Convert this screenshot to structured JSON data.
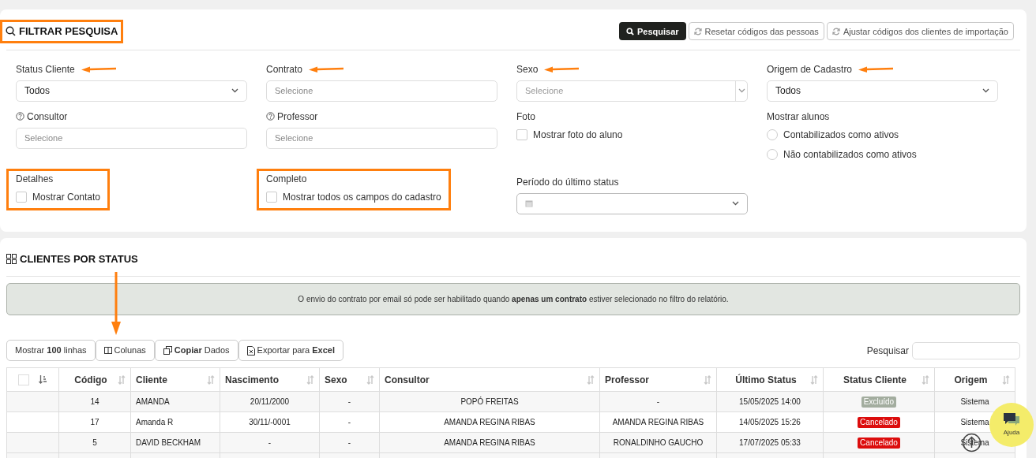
{
  "filter_panel": {
    "title": "FILTRAR PESQUISA",
    "title_highlighted": true,
    "buttons": [
      {
        "label": "Pesquisar",
        "kind": "primary"
      },
      {
        "label": "Resetar códigos das pessoas",
        "kind": "refresh"
      },
      {
        "label": "Ajustar códigos dos clientes de importação",
        "kind": "refresh"
      }
    ],
    "fields": [
      {
        "kind": "select",
        "label": "Status Cliente",
        "value": "Todos",
        "arrow": true,
        "help": false,
        "highlighted": false
      },
      {
        "kind": "input",
        "label": "Contrato",
        "placeholder": "Selecione",
        "arrow": true,
        "help": false,
        "highlighted": false
      },
      {
        "kind": "combo",
        "label": "Sexo",
        "placeholder": "Selecione",
        "arrow": true,
        "help": false,
        "highlighted": false
      },
      {
        "kind": "select",
        "label": "Origem de Cadastro",
        "value": "Todos",
        "arrow": true,
        "help": false,
        "highlighted": false
      },
      {
        "kind": "input",
        "label": "Consultor",
        "placeholder": "Selecione",
        "arrow": false,
        "help": true,
        "highlighted": false
      },
      {
        "kind": "input",
        "label": "Professor",
        "placeholder": "Selecione",
        "arrow": false,
        "help": true,
        "highlighted": false
      },
      {
        "kind": "checkbox",
        "label": "Foto",
        "option": "Mostrar foto do aluno",
        "checked": false,
        "arrow": false,
        "help": false,
        "highlighted": false
      },
      {
        "kind": "radios",
        "label": "Mostrar alunos",
        "options": [
          {
            "label": "Contabilizados como ativos",
            "selected": false
          },
          {
            "label": "Não contabilizados como ativos",
            "selected": false
          }
        ],
        "arrow": false,
        "help": false,
        "highlighted": false
      },
      {
        "kind": "checkbox",
        "label": "Detalhes",
        "option": "Mostrar Contato",
        "checked": false,
        "arrow": false,
        "help": false,
        "highlighted": true
      },
      {
        "kind": "checkbox",
        "label": "Completo",
        "option": "Mostrar todos os campos do cadastro",
        "checked": false,
        "arrow": false,
        "help": false,
        "highlighted": true
      },
      {
        "kind": "date",
        "label": "Período do último status",
        "arrow": false,
        "help": false,
        "highlighted": false
      }
    ]
  },
  "clients_panel": {
    "title": "CLIENTES POR STATUS",
    "alert": "O envio do contrato por email só pode ser habilitado quando **apenas um contrato** estiver selecionado no filtro do relatório.",
    "toolbar": [
      {
        "kind": "length",
        "label": "Mostrar **100** linhas",
        "arrow": false
      },
      {
        "kind": "columns",
        "label": "Colunas",
        "arrow": true
      },
      {
        "kind": "copy",
        "label": "**Copiar** Dados",
        "arrow": false
      },
      {
        "kind": "excel",
        "label": "Exportar para **Excel**",
        "arrow": false
      }
    ],
    "search_label": "Pesquisar",
    "table": {
      "select_all_checked": false,
      "columns": [
        "Código",
        "Cliente",
        "Nascimento",
        "Sexo",
        "Consultor",
        "Professor",
        "Último Status",
        "Status Cliente",
        "Origem"
      ],
      "rows": [
        {
          "cells": [
            "14",
            "AMANDA",
            "20/11/2000",
            "-",
            "POPÓ FREITAS",
            "-",
            "15/05/2025 14:00"
          ],
          "status": {
            "label": "Excluído",
            "color": "#a3ad9f"
          },
          "origin": "Sistema"
        },
        {
          "cells": [
            "17",
            "Amanda R",
            "30/11/-0001",
            "-",
            "AMANDA REGINA RIBAS",
            "AMANDA REGINA RIBAS",
            "14/05/2025 15:26"
          ],
          "status": {
            "label": "Cancelado",
            "color": "#dc0d0d"
          },
          "origin": "Sistema"
        },
        {
          "cells": [
            "5",
            "DAVID BECKHAM",
            "-",
            "-",
            "AMANDA REGINA RIBAS",
            "RONALDINHO GAUCHO",
            "17/07/2025 05:33"
          ],
          "status": {
            "label": "Cancelado",
            "color": "#dc0d0d"
          },
          "origin": "Sistema"
        }
      ]
    }
  },
  "help_button": {
    "label": "Ajuda"
  }
}
